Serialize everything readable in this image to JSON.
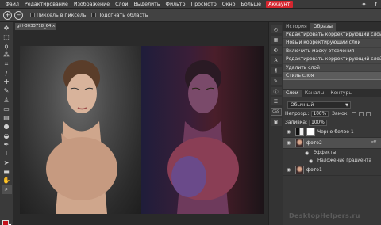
{
  "menu": {
    "items": [
      "Файл",
      "Редактирование",
      "Изображение",
      "Слой",
      "Выделить",
      "Фильтр",
      "Просмотр",
      "Окно",
      "Больше"
    ],
    "account": "Аккаунт"
  },
  "options_bar": {
    "pixel_to_pixel": "Пиксель в пиксель",
    "fit_area": "Подогнать область"
  },
  "document": {
    "tab_title": "girl-3033718_64",
    "close": "×"
  },
  "colors": {
    "foreground": "#c4121b",
    "background": "#ffffff",
    "accent": "#d5262f"
  },
  "side_strip": {
    "css_label": "CSS"
  },
  "history_panel": {
    "tabs": [
      "История",
      "Образы"
    ],
    "items": [
      "Редактировать корректирующий слой",
      "Новый корректирующий слой",
      "Включить маску отсечения",
      "Редактировать корректирующий слой",
      "Удалить слой",
      "Стиль слоя"
    ],
    "selected_index": 5
  },
  "layers_panel": {
    "tabs": [
      "Слои",
      "Каналы",
      "Контуры"
    ],
    "blend_mode": "Обычный",
    "opacity_label": "Непрозр.:",
    "opacity_value": "100%",
    "lock_label": "Замок:",
    "fill_label": "Заливка:",
    "fill_value": "100%",
    "layers": [
      {
        "name": "Черно-белое 1"
      },
      {
        "name": "фото2",
        "fx": "eff"
      },
      {
        "name": "фото1"
      }
    ],
    "effects_label": "Эффекты",
    "gradient_overlay_label": "Наложение градиента"
  },
  "watermark": "DesktopHelpers.ru"
}
